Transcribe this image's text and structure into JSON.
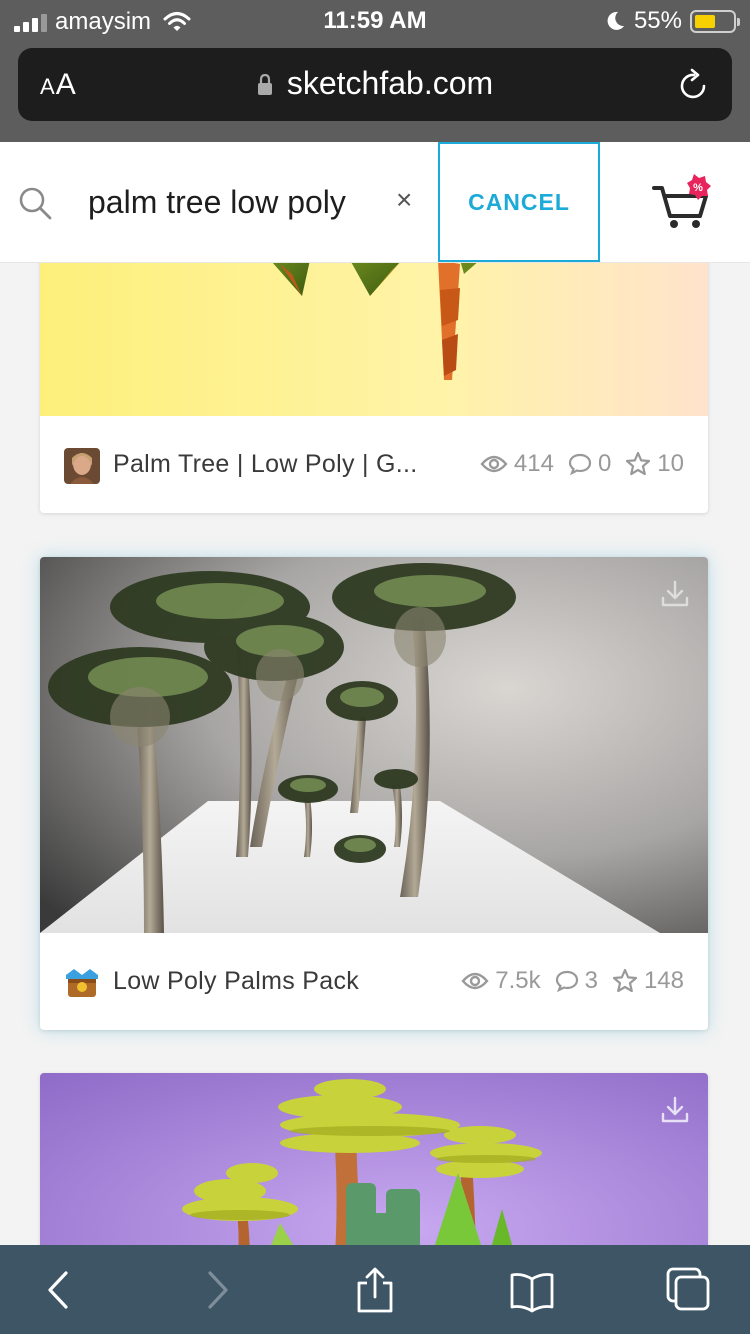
{
  "status_bar": {
    "carrier": "amaysim",
    "time": "11:59 AM",
    "battery_percent": "55%",
    "signal_bars": 3,
    "battery_level": 0.55
  },
  "browser": {
    "text_size_label_small": "A",
    "text_size_label_large": "A",
    "url": "sketchfab.com"
  },
  "search": {
    "query": "palm tree low poly",
    "clear_symbol": "×",
    "cancel_label": "CANCEL",
    "cart_badge_symbol": "%"
  },
  "results": [
    {
      "title": "Palm Tree | Low Poly | G...",
      "views": "414",
      "comments": "0",
      "likes": "10"
    },
    {
      "title": "Low Poly Palms Pack",
      "views": "7.5k",
      "comments": "3",
      "likes": "148"
    },
    {
      "title": ""
    }
  ],
  "colors": {
    "accent": "#1caad9",
    "cart_badge": "#e8245c",
    "toolbar": "#3e5566",
    "battery": "#f7d000"
  },
  "icons": [
    "signal-icon",
    "wifi-icon",
    "moon-icon",
    "battery-icon",
    "lock-icon",
    "reload-icon",
    "search-icon",
    "cart-icon",
    "download-icon",
    "eye-icon",
    "comment-icon",
    "star-icon",
    "back-icon",
    "forward-icon",
    "share-icon",
    "bookmarks-icon",
    "tabs-icon"
  ]
}
